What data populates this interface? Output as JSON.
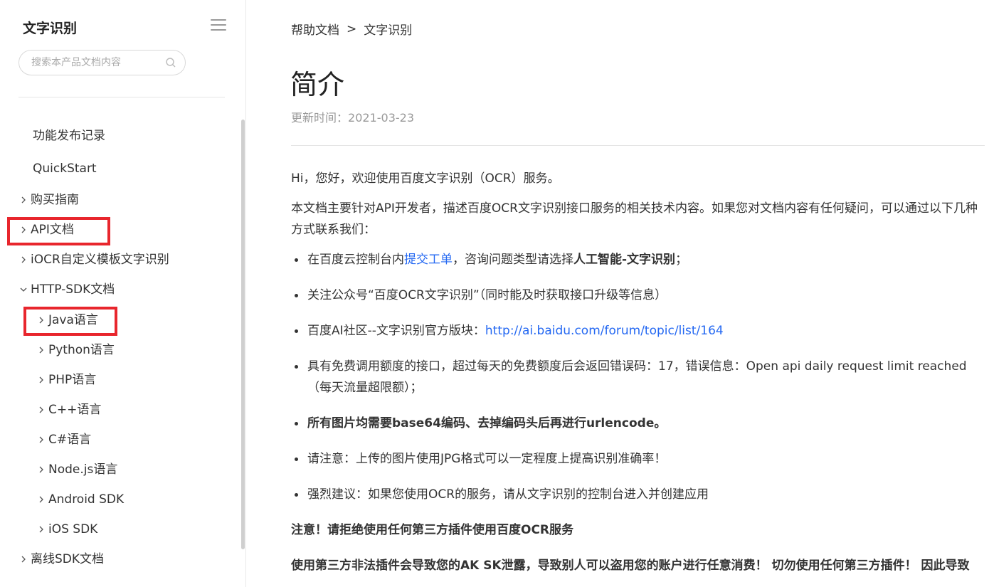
{
  "sidebar": {
    "title": "文字识别",
    "search_placeholder": "搜索本产品文档内容",
    "items": [
      {
        "label": "功能发布记录"
      },
      {
        "label": "QuickStart"
      },
      {
        "label": "购买指南"
      },
      {
        "label": "API文档"
      },
      {
        "label": "iOCR自定义模板文字识别"
      },
      {
        "label": "HTTP-SDK文档"
      },
      {
        "label": "Java语言"
      },
      {
        "label": "Python语言"
      },
      {
        "label": "PHP语言"
      },
      {
        "label": "C++语言"
      },
      {
        "label": "C#语言"
      },
      {
        "label": "Node.js语言"
      },
      {
        "label": "Android SDK"
      },
      {
        "label": "iOS SDK"
      },
      {
        "label": "离线SDK文档"
      }
    ],
    "highlight_color": "#e8262d"
  },
  "breadcrumb": {
    "items": [
      "帮助文档",
      "文字识别"
    ],
    "separator": ">"
  },
  "article": {
    "title": "简介",
    "update_label": "更新时间：",
    "update_date": "2021-03-23",
    "intro": "Hi，您好，欢迎使用百度文字识别（OCR）服务。",
    "desc": "本文档主要针对API开发者，描述百度OCR文字识别接口服务的相关技术内容。如果您对文档内容有任何疑问，可以通过以下几种方式联系我们：",
    "bullets": {
      "b1_prefix": "在百度云控制台内",
      "b1_link": "提交工单",
      "b1_mid": "，咨询问题类型请选择",
      "b1_bold": "人工智能-文字识别",
      "b1_suffix": "；",
      "b2": "关注公众号“百度OCR文字识别”（同时能及时获取接口升级等信息）",
      "b3_prefix": "百度AI社区--文字识别官方版块：",
      "b3_link": "http://ai.baidu.com/forum/topic/list/164",
      "b4": "具有免费调用额度的接口，超过每天的免费额度后会返回错误码：17，错误信息：Open api daily request limit reached（每天流量超限额）；",
      "b5": "所有图片均需要base64编码、去掉编码头后再进行urlencode。",
      "b6": "请注意：上传的图片使用JPG格式可以一定程度上提高识别准确率！",
      "b7": "强烈建议：如果您使用OCR的服务，请从文字识别的控制台进入并创建应用"
    },
    "note1": "注意！请拒绝使用任何第三方插件使用百度OCR服务",
    "note2": "使用第三方非法插件会导致您的AK SK泄露，导致别人可以盗用您的账户进行任意消费！ 切勿使用任何第三方插件！ 因此导致"
  },
  "colors": {
    "link": "#2468f2",
    "text": "#333333",
    "muted": "#999999"
  }
}
